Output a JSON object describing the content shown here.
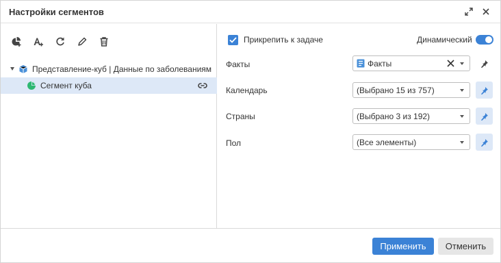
{
  "dialog": {
    "title": "Настройки сегментов"
  },
  "tree": {
    "root_label": "Представление-куб | Данные по заболеваниям",
    "child_label": "Сегмент куба"
  },
  "settings": {
    "attach_label": "Прикрепить к задаче",
    "attach_checked": true,
    "dynamic_label": "Динамический",
    "dynamic_on": true,
    "fields": [
      {
        "label": "Факты",
        "value": "Факты",
        "pinned": false
      },
      {
        "label": "Календарь",
        "value": "(Выбрано 15 из 757)",
        "pinned": true
      },
      {
        "label": "Страны",
        "value": "(Выбрано 3 из 192)",
        "pinned": true
      },
      {
        "label": "Пол",
        "value": "(Все элементы)",
        "pinned": true
      }
    ]
  },
  "footer": {
    "apply_label": "Применить",
    "cancel_label": "Отменить"
  },
  "colors": {
    "accent": "#3b82d6",
    "selection": "#dde8f7",
    "cube_icon": "#4a90d9",
    "segment_icon": "#2eb872"
  }
}
